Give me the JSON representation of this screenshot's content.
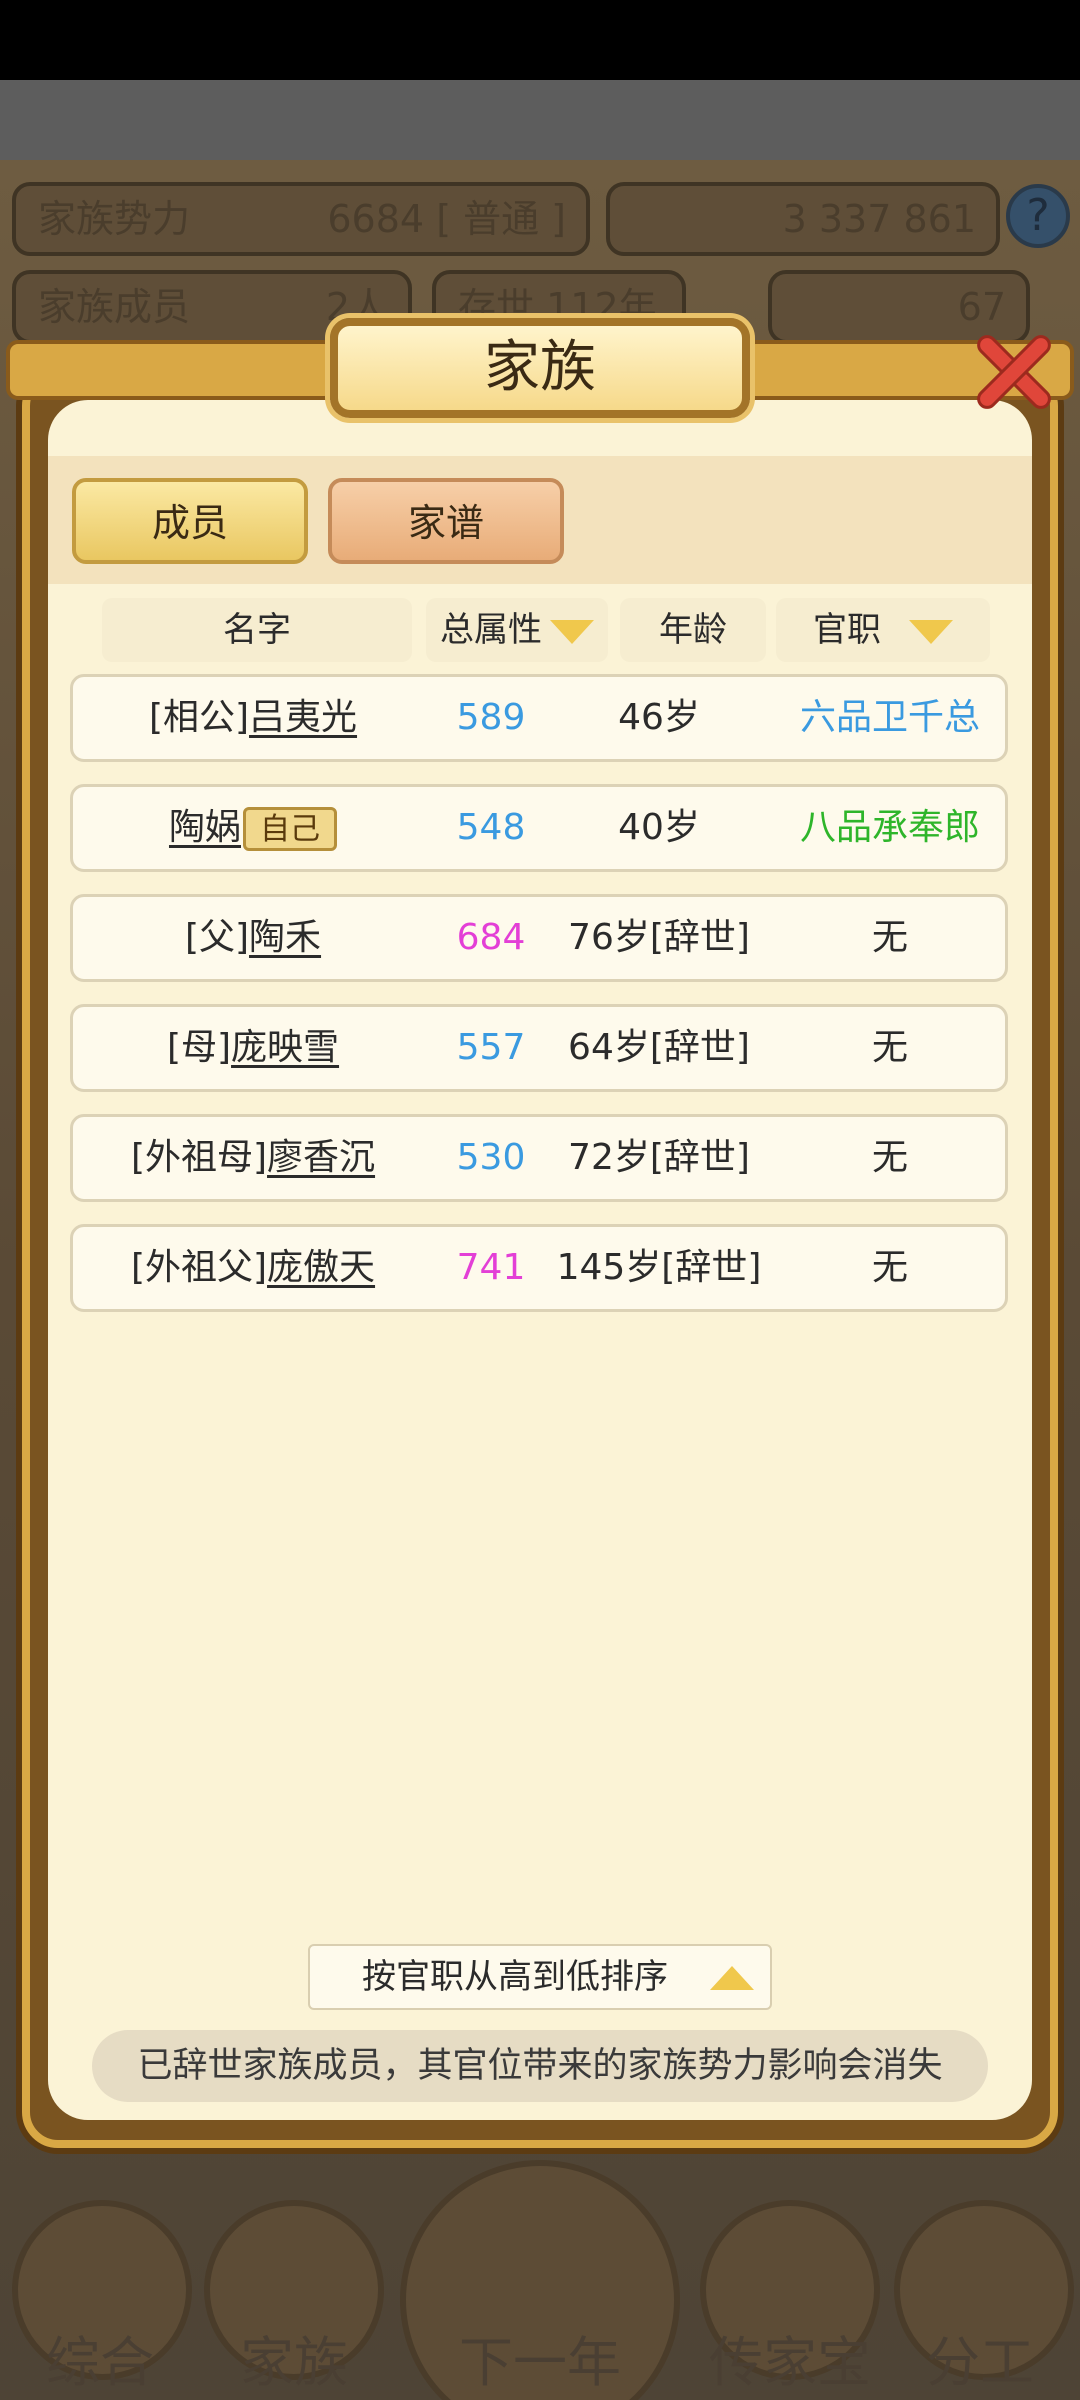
{
  "background": {
    "family_power_label": "家族势力",
    "family_power_value": "6684",
    "family_power_rank": "[ 普通 ]",
    "resources": "3  337  861",
    "members_label": "家族成员",
    "members_value": "2人",
    "existence_label": "存世",
    "existence_value": "112年",
    "gold_value": "67"
  },
  "modal": {
    "title": "家族",
    "tabs": [
      {
        "label": "成员"
      },
      {
        "label": "家谱"
      }
    ],
    "columns": {
      "name": "名字",
      "attr": "总属性",
      "age": "年龄",
      "title": "官职"
    },
    "rows": [
      {
        "prefix": "[相公]",
        "name": "吕夷光",
        "attr": "589",
        "age": "46岁",
        "title": "六品卫千总"
      },
      {
        "prefix": "",
        "name": "陶娲",
        "badge": "自己",
        "attr": "548",
        "age": "40岁",
        "title": "八品承奉郎"
      },
      {
        "prefix": "[父]",
        "name": "陶禾",
        "attr": "684",
        "age": "76岁[辞世]",
        "title": "无"
      },
      {
        "prefix": "[母]",
        "name": "庞映雪",
        "attr": "557",
        "age": "64岁[辞世]",
        "title": "无"
      },
      {
        "prefix": "[外祖母]",
        "name": "廖香沉",
        "attr": "530",
        "age": "72岁[辞世]",
        "title": "无"
      },
      {
        "prefix": "[外祖父]",
        "name": "庞傲天",
        "attr": "741",
        "age": "145岁[辞世]",
        "title": "无"
      }
    ],
    "sort_button": "按官职从高到低排序",
    "notice": "已辞世家族成员，其官位带来的家族势力影响会消失"
  },
  "bottom_nav": [
    {
      "label": "综合"
    },
    {
      "label": "家族"
    },
    {
      "label": "下一年"
    },
    {
      "label": "传家宝"
    },
    {
      "label": "分工"
    }
  ],
  "colors": {
    "attr_blue": "#3a9ae0",
    "attr_pink": "#e33fd6",
    "title_blue": "#3a9ae0",
    "title_green": "#2eb52a"
  }
}
